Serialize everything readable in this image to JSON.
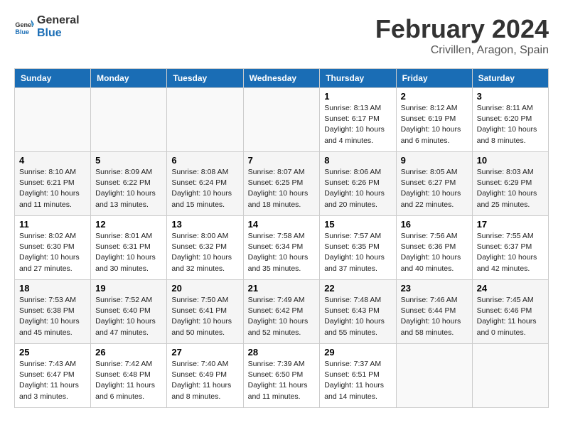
{
  "header": {
    "logo_line1": "General",
    "logo_line2": "Blue",
    "month": "February 2024",
    "location": "Crivillen, Aragon, Spain"
  },
  "days_of_week": [
    "Sunday",
    "Monday",
    "Tuesday",
    "Wednesday",
    "Thursday",
    "Friday",
    "Saturday"
  ],
  "weeks": [
    [
      {
        "day": "",
        "info": ""
      },
      {
        "day": "",
        "info": ""
      },
      {
        "day": "",
        "info": ""
      },
      {
        "day": "",
        "info": ""
      },
      {
        "day": "1",
        "info": "Sunrise: 8:13 AM\nSunset: 6:17 PM\nDaylight: 10 hours and 4 minutes."
      },
      {
        "day": "2",
        "info": "Sunrise: 8:12 AM\nSunset: 6:19 PM\nDaylight: 10 hours and 6 minutes."
      },
      {
        "day": "3",
        "info": "Sunrise: 8:11 AM\nSunset: 6:20 PM\nDaylight: 10 hours and 8 minutes."
      }
    ],
    [
      {
        "day": "4",
        "info": "Sunrise: 8:10 AM\nSunset: 6:21 PM\nDaylight: 10 hours and 11 minutes."
      },
      {
        "day": "5",
        "info": "Sunrise: 8:09 AM\nSunset: 6:22 PM\nDaylight: 10 hours and 13 minutes."
      },
      {
        "day": "6",
        "info": "Sunrise: 8:08 AM\nSunset: 6:24 PM\nDaylight: 10 hours and 15 minutes."
      },
      {
        "day": "7",
        "info": "Sunrise: 8:07 AM\nSunset: 6:25 PM\nDaylight: 10 hours and 18 minutes."
      },
      {
        "day": "8",
        "info": "Sunrise: 8:06 AM\nSunset: 6:26 PM\nDaylight: 10 hours and 20 minutes."
      },
      {
        "day": "9",
        "info": "Sunrise: 8:05 AM\nSunset: 6:27 PM\nDaylight: 10 hours and 22 minutes."
      },
      {
        "day": "10",
        "info": "Sunrise: 8:03 AM\nSunset: 6:29 PM\nDaylight: 10 hours and 25 minutes."
      }
    ],
    [
      {
        "day": "11",
        "info": "Sunrise: 8:02 AM\nSunset: 6:30 PM\nDaylight: 10 hours and 27 minutes."
      },
      {
        "day": "12",
        "info": "Sunrise: 8:01 AM\nSunset: 6:31 PM\nDaylight: 10 hours and 30 minutes."
      },
      {
        "day": "13",
        "info": "Sunrise: 8:00 AM\nSunset: 6:32 PM\nDaylight: 10 hours and 32 minutes."
      },
      {
        "day": "14",
        "info": "Sunrise: 7:58 AM\nSunset: 6:34 PM\nDaylight: 10 hours and 35 minutes."
      },
      {
        "day": "15",
        "info": "Sunrise: 7:57 AM\nSunset: 6:35 PM\nDaylight: 10 hours and 37 minutes."
      },
      {
        "day": "16",
        "info": "Sunrise: 7:56 AM\nSunset: 6:36 PM\nDaylight: 10 hours and 40 minutes."
      },
      {
        "day": "17",
        "info": "Sunrise: 7:55 AM\nSunset: 6:37 PM\nDaylight: 10 hours and 42 minutes."
      }
    ],
    [
      {
        "day": "18",
        "info": "Sunrise: 7:53 AM\nSunset: 6:38 PM\nDaylight: 10 hours and 45 minutes."
      },
      {
        "day": "19",
        "info": "Sunrise: 7:52 AM\nSunset: 6:40 PM\nDaylight: 10 hours and 47 minutes."
      },
      {
        "day": "20",
        "info": "Sunrise: 7:50 AM\nSunset: 6:41 PM\nDaylight: 10 hours and 50 minutes."
      },
      {
        "day": "21",
        "info": "Sunrise: 7:49 AM\nSunset: 6:42 PM\nDaylight: 10 hours and 52 minutes."
      },
      {
        "day": "22",
        "info": "Sunrise: 7:48 AM\nSunset: 6:43 PM\nDaylight: 10 hours and 55 minutes."
      },
      {
        "day": "23",
        "info": "Sunrise: 7:46 AM\nSunset: 6:44 PM\nDaylight: 10 hours and 58 minutes."
      },
      {
        "day": "24",
        "info": "Sunrise: 7:45 AM\nSunset: 6:46 PM\nDaylight: 11 hours and 0 minutes."
      }
    ],
    [
      {
        "day": "25",
        "info": "Sunrise: 7:43 AM\nSunset: 6:47 PM\nDaylight: 11 hours and 3 minutes."
      },
      {
        "day": "26",
        "info": "Sunrise: 7:42 AM\nSunset: 6:48 PM\nDaylight: 11 hours and 6 minutes."
      },
      {
        "day": "27",
        "info": "Sunrise: 7:40 AM\nSunset: 6:49 PM\nDaylight: 11 hours and 8 minutes."
      },
      {
        "day": "28",
        "info": "Sunrise: 7:39 AM\nSunset: 6:50 PM\nDaylight: 11 hours and 11 minutes."
      },
      {
        "day": "29",
        "info": "Sunrise: 7:37 AM\nSunset: 6:51 PM\nDaylight: 11 hours and 14 minutes."
      },
      {
        "day": "",
        "info": ""
      },
      {
        "day": "",
        "info": ""
      }
    ]
  ]
}
